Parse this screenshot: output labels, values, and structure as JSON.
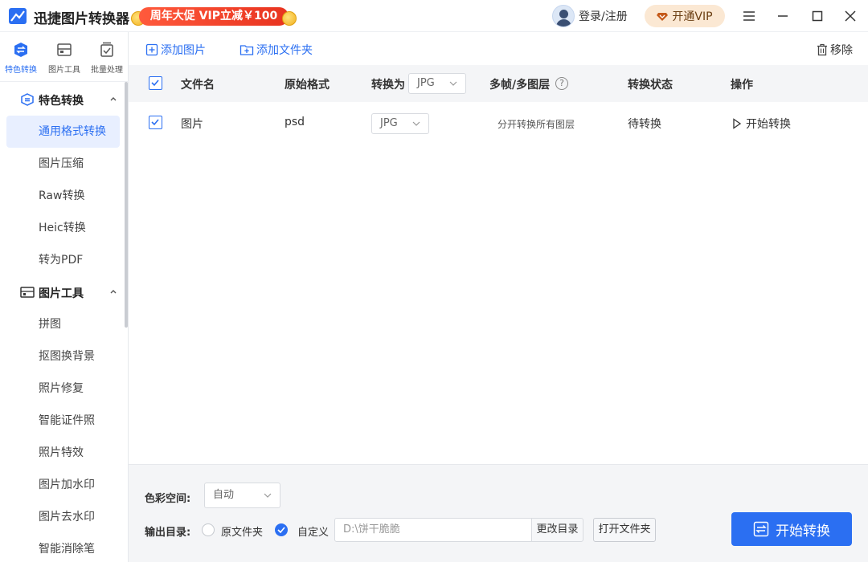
{
  "app": {
    "title": "迅捷图片转换器"
  },
  "promo": {
    "text": "周年大促 VIP立减￥100"
  },
  "user": {
    "login_label": "登录/注册"
  },
  "vip": {
    "label": "开通VIP"
  },
  "rail": {
    "tabs": [
      {
        "label": "特色转换",
        "icon": "convert-icon",
        "active": true
      },
      {
        "label": "图片工具",
        "icon": "image-tool-icon",
        "active": false
      },
      {
        "label": "批量处理",
        "icon": "batch-icon",
        "active": false
      }
    ],
    "sections": [
      {
        "title": "特色转换",
        "icon": "convert-icon",
        "items": [
          "通用格式转换",
          "图片压缩",
          "Raw转换",
          "Heic转换",
          "转为PDF"
        ]
      },
      {
        "title": "图片工具",
        "icon": "image-tool-icon",
        "items": [
          "拼图",
          "抠图换背景",
          "照片修复",
          "智能证件照",
          "照片特效",
          "图片加水印",
          "图片去水印",
          "智能消除笔"
        ]
      }
    ]
  },
  "toolbar": {
    "add_image": "添加图片",
    "add_folder": "添加文件夹",
    "remove": "移除"
  },
  "table": {
    "headers": {
      "filename": "文件名",
      "orig_format": "原始格式",
      "convert_to": "转换为",
      "convert_to_value": "JPG",
      "frames": "多帧/多图层",
      "status": "转换状态",
      "action": "操作"
    },
    "rows": [
      {
        "filename": "图片",
        "orig_format": "psd",
        "target": "JPG",
        "frames": "分开转换所有图层",
        "status": "待转换",
        "action": "开始转换"
      }
    ]
  },
  "bottom": {
    "color_space_label": "色彩空间:",
    "color_space_value": "自动",
    "output_label": "输出目录:",
    "option_original": "原文件夹",
    "option_custom": "自定义",
    "path_placeholder": "D:\\饼干脆脆",
    "change_dir": "更改目录",
    "open_folder": "打开文件夹",
    "start": "开始转换"
  },
  "colors": {
    "accent": "#2b6ff2",
    "promo": "#e8331f",
    "vip_bg": "#fbe8d3"
  }
}
